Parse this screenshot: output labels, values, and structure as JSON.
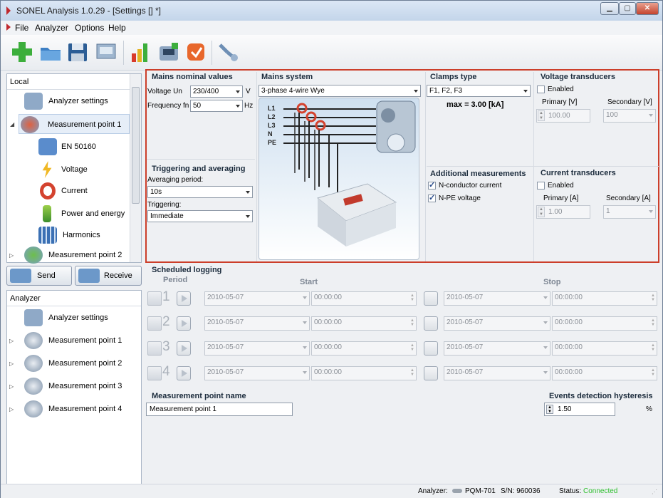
{
  "window": {
    "title": "SONEL Analysis 1.0.29 - [Settings [] *]"
  },
  "menu": [
    "File",
    "Analyzer",
    "Options",
    "Help"
  ],
  "toolbar": [
    "new-icon",
    "open-icon",
    "save-icon",
    "analyzer-settings-icon",
    "chart-icon",
    "analyzer-icon",
    "report-icon",
    "connect-icon"
  ],
  "local": {
    "header": "Local",
    "items": [
      {
        "label": "Analyzer settings",
        "icon": "analyzer-settings-icon"
      },
      {
        "label": "Measurement point 1",
        "icon": "measurement-point-icon",
        "selected": true
      },
      {
        "label": "EN 50160",
        "icon": "en50160-icon"
      },
      {
        "label": "Voltage",
        "icon": "voltage-icon"
      },
      {
        "label": "Current",
        "icon": "current-clamp-icon"
      },
      {
        "label": "Power and energy",
        "icon": "power-icon"
      },
      {
        "label": "Harmonics",
        "icon": "harmonics-icon"
      },
      {
        "label": "Measurement point 2",
        "icon": "measurement-point-icon"
      }
    ]
  },
  "buttons": {
    "send": "Send",
    "receive": "Receive"
  },
  "analyzer": {
    "header": "Analyzer",
    "items": [
      {
        "label": "Analyzer settings"
      },
      {
        "label": "Measurement point 1"
      },
      {
        "label": "Measurement point 2"
      },
      {
        "label": "Measurement point 3"
      },
      {
        "label": "Measurement point 4"
      }
    ]
  },
  "mains_nominal": {
    "title": "Mains nominal values",
    "voltage_label": "Voltage Un",
    "voltage_value": "230/400",
    "voltage_unit": "V",
    "freq_label": "Frequency fn",
    "freq_value": "50",
    "freq_unit": "Hz"
  },
  "triggering": {
    "title": "Triggering and averaging",
    "avg_label": "Averaging period:",
    "avg_value": "10s",
    "trig_label": "Triggering:",
    "trig_value": "Immediate"
  },
  "mains_system": {
    "title": "Mains system",
    "value": "3-phase 4-wire Wye",
    "phases": [
      "L1",
      "L2",
      "L3",
      "N",
      "PE"
    ]
  },
  "clamps": {
    "title": "Clamps type",
    "value": "F1, F2, F3",
    "max": "max = 3.00 [kA]"
  },
  "additional": {
    "title": "Additional measurements",
    "n_current": "N-conductor current",
    "npe_voltage": "N-PE voltage"
  },
  "voltage_transducers": {
    "title": "Voltage transducers",
    "enabled": "Enabled",
    "primary_label": "Primary [V]",
    "secondary_label": "Secondary [V]",
    "primary_value": "100.00",
    "secondary_value": "100"
  },
  "current_transducers": {
    "title": "Current transducers",
    "enabled": "Enabled",
    "primary_label": "Primary [A]",
    "secondary_label": "Secondary [A]",
    "primary_value": "1.00",
    "secondary_value": "1"
  },
  "logging": {
    "title": "Scheduled logging",
    "period": "Period",
    "start": "Start",
    "stop": "Stop",
    "rows": [
      {
        "n": "1",
        "sdate": "2010-05-07",
        "stime": "00:00:00",
        "edate": "2010-05-07",
        "etime": "00:00:00"
      },
      {
        "n": "2",
        "sdate": "2010-05-07",
        "stime": "00:00:00",
        "edate": "2010-05-07",
        "etime": "00:00:00"
      },
      {
        "n": "3",
        "sdate": "2010-05-07",
        "stime": "00:00:00",
        "edate": "2010-05-07",
        "etime": "00:00:00"
      },
      {
        "n": "4",
        "sdate": "2010-05-07",
        "stime": "00:00:00",
        "edate": "2010-05-07",
        "etime": "00:00:00"
      }
    ]
  },
  "mp_name": {
    "title": "Measurement point name",
    "value": "Measurement point 1"
  },
  "hysteresis": {
    "title": "Events detection hysteresis",
    "value": "1.50",
    "unit": "%"
  },
  "status": {
    "analyzer_label": "Analyzer:",
    "model": "PQM-701",
    "sn": "S/N: 960036",
    "status_label": "Status:",
    "status_value": "Connected",
    "status_color": "#2fbf2f"
  }
}
